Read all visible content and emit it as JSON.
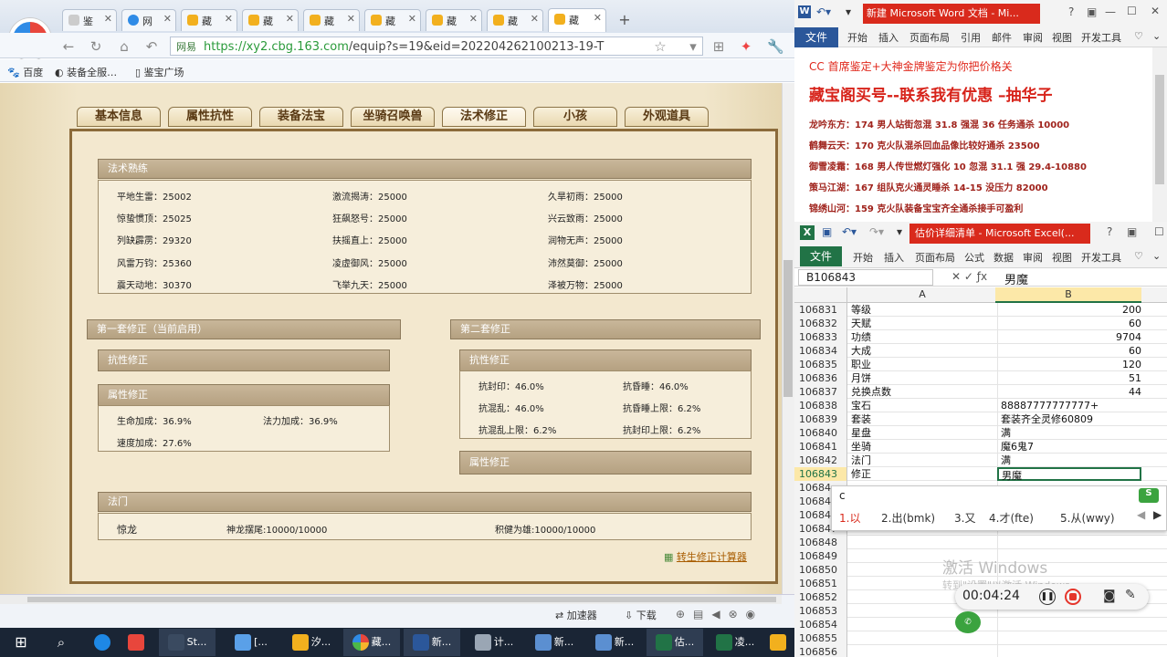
{
  "browser": {
    "tabs": [
      {
        "label": "鉴"
      },
      {
        "label": "网"
      },
      {
        "label": "藏"
      },
      {
        "label": "藏"
      },
      {
        "label": "藏"
      },
      {
        "label": "藏"
      },
      {
        "label": "藏"
      },
      {
        "label": "藏"
      },
      {
        "label": "藏"
      }
    ],
    "url_site": "网易",
    "url_scheme": "https://",
    "url_host": "xy2.cbg.163.com",
    "url_path": "/equip?s=19&eid=202204262100213-19-T",
    "bookmarks": [
      "百度",
      "装备全服…",
      "鉴宝广场"
    ],
    "status": {
      "accelerator": "加速器",
      "download": "下载"
    }
  },
  "game": {
    "tabs": [
      {
        "label": "基本信息"
      },
      {
        "label": "属性抗性"
      },
      {
        "label": "装备法宝"
      },
      {
        "label": "坐骑召唤兽"
      },
      {
        "label": "法术修正"
      },
      {
        "label": "小孩"
      },
      {
        "label": "外观道具"
      }
    ],
    "proficiency": {
      "title": "法术熟练",
      "rows": [
        [
          "平地生雷：25002",
          "激流揭涛：25000",
          "久旱初雨：25000"
        ],
        [
          "惊蛰惯顶：25025",
          "狂飙怒号：25000",
          "兴云致雨：25000"
        ],
        [
          "列缺霹雳：29320",
          "扶摇直上：25000",
          "润物无声：25000"
        ],
        [
          "风雷万钧：25360",
          "凌虚御风：25000",
          "沛然莫御：25000"
        ],
        [
          "震天动地：30370",
          "飞举九天：25000",
          "泽被万物：25000"
        ]
      ]
    },
    "set1": {
      "title": "第一套修正（当前启用）",
      "resist_title": "抗性修正",
      "attr_title": "属性修正",
      "attr": [
        "生命加成：36.9%",
        "法力加成：36.9%",
        "速度加成：27.6%"
      ]
    },
    "set2": {
      "title": "第二套修正",
      "resist_title": "抗性修正",
      "resist": [
        "抗封印：46.0%",
        "抗昏睡：46.0%",
        "抗混乱：46.0%",
        "抗昏睡上限：6.2%",
        "抗混乱上限：6.2%",
        "抗封印上限：6.2%"
      ],
      "attr_title": "属性修正"
    },
    "famen": {
      "title": "法门",
      "name": "惊龙",
      "item1": "神龙摆尾:10000/10000",
      "item2": "积健为雄:10000/10000"
    },
    "calc_link": "转生修正计算器"
  },
  "word": {
    "title": "新建 Microsoft Word 文档 - Mi...",
    "tabs": [
      "文件",
      "开始",
      "插入",
      "页面布局",
      "引用",
      "邮件",
      "审阅",
      "视图",
      "开发工具"
    ],
    "lines": [
      "CC 首席鉴定+大神金牌鉴定为你把价格关",
      "藏宝阁买号--联系我有优惠 –抽华子",
      "龙吟东方：174 男人站街忽混 31.8 强混 36 任务通杀 10000",
      "鹤舞云天：170 克火队混杀回血品像比较好通杀 23500",
      "御雪凌霜：168 男人传世燃灯强化 10 忽混 31.1 强 29.4-10880",
      "策马江湖：167 组队克火通灵睡杀 14-15 没压力 82000",
      "锦绣山河：159 克火队装备宝宝齐全通杀接手可盈利"
    ]
  },
  "excel": {
    "title": "估价详细清单 - Microsoft Excel(...",
    "tabs": [
      "文件",
      "开始",
      "插入",
      "页面布局",
      "公式",
      "数据",
      "审阅",
      "视图",
      "开发工具"
    ],
    "namebox": "B106843",
    "formula": "男魔",
    "col_a": "A",
    "col_b": "B",
    "rows": [
      {
        "n": "106831",
        "a": "等级",
        "b": "200",
        "left": false
      },
      {
        "n": "106832",
        "a": "天赋",
        "b": "60",
        "left": false
      },
      {
        "n": "106833",
        "a": "功绩",
        "b": "9704",
        "left": false
      },
      {
        "n": "106834",
        "a": "大成",
        "b": "60",
        "left": false
      },
      {
        "n": "106835",
        "a": "职业",
        "b": "120",
        "left": false
      },
      {
        "n": "106836",
        "a": "月饼",
        "b": "51",
        "left": false
      },
      {
        "n": "106837",
        "a": "兑换点数",
        "b": "44",
        "left": false
      },
      {
        "n": "106838",
        "a": "宝石",
        "b": "88887777777777+",
        "left": true
      },
      {
        "n": "106839",
        "a": "套装",
        "b": "套装齐全灵修60809",
        "left": true
      },
      {
        "n": "106840",
        "a": "星盘",
        "b": "满",
        "left": true
      },
      {
        "n": "106841",
        "a": "坐骑",
        "b": "魔6鬼7",
        "left": true
      },
      {
        "n": "106842",
        "a": "法门",
        "b": "满",
        "left": true
      },
      {
        "n": "106843",
        "a": "修正",
        "b": "男魔",
        "left": true
      },
      {
        "n": "10684",
        "a": "",
        "b": "",
        "left": true
      },
      {
        "n": "10684",
        "a": "",
        "b": "",
        "left": true
      },
      {
        "n": "10684",
        "a": "",
        "b": "",
        "left": true
      },
      {
        "n": "106847",
        "a": "",
        "b": "",
        "left": true
      },
      {
        "n": "106848",
        "a": "",
        "b": "",
        "left": true
      },
      {
        "n": "106849",
        "a": "",
        "b": "",
        "left": true
      },
      {
        "n": "106850",
        "a": "",
        "b": "",
        "left": true
      },
      {
        "n": "106851",
        "a": "",
        "b": "",
        "left": true
      },
      {
        "n": "106852",
        "a": "",
        "b": "",
        "left": true
      },
      {
        "n": "106853",
        "a": "",
        "b": "",
        "left": true
      },
      {
        "n": "106854",
        "a": "",
        "b": "",
        "left": true
      },
      {
        "n": "106855",
        "a": "",
        "b": "",
        "left": true
      },
      {
        "n": "106856",
        "a": "",
        "b": "",
        "left": true
      }
    ],
    "ime_input": "c",
    "ime_candidates": [
      "1.以",
      "2.出(bmk)",
      "3.又",
      "4.才(fte)",
      "5.从(wwy)"
    ],
    "watermark": "激活 Windows",
    "watermark_sub": "转到\"设置\"以激活 Windows。",
    "recorder_time": "00:04:24"
  },
  "taskbar": {
    "items": [
      "St...",
      "[...",
      "汐...",
      "藏...",
      "新...",
      "计...",
      "新...",
      "新...",
      "估...",
      "凌..."
    ]
  },
  "colors": {
    "accent_red": "#d92a1c",
    "word_blue": "#2b579a",
    "excel_green": "#217346",
    "tab_brown": "#8b6a3a"
  }
}
